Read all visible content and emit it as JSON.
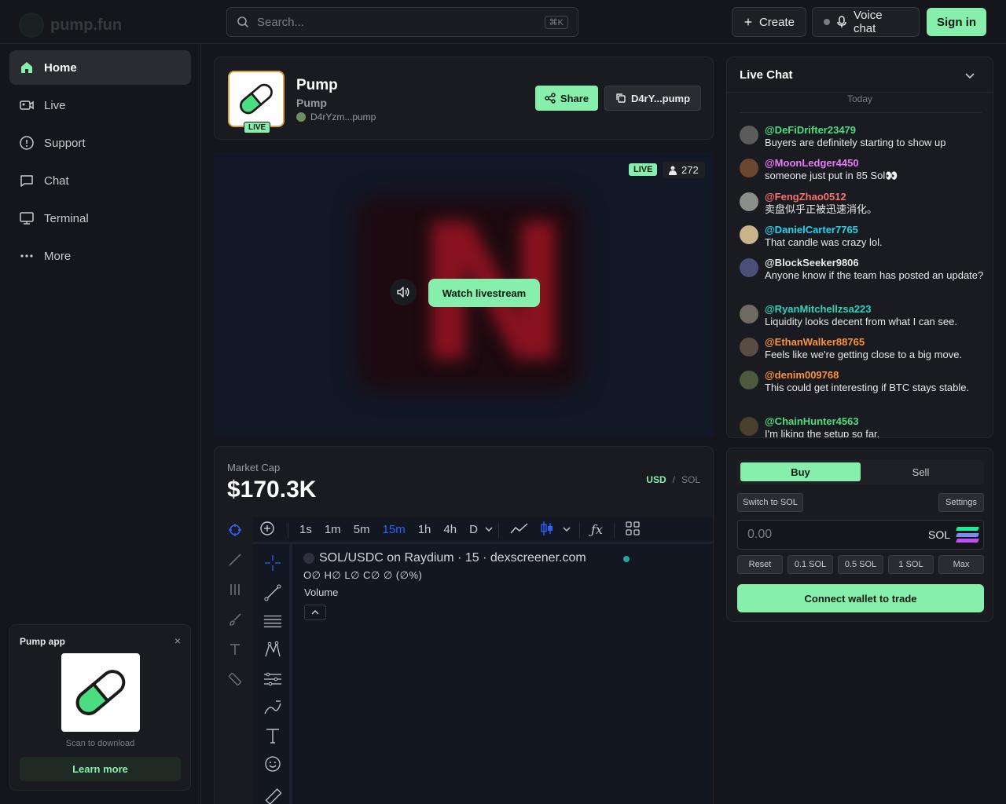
{
  "header": {
    "logo_text": "pump.fun",
    "search_placeholder": "Search...",
    "search_shortcut": "⌘K",
    "create_label": "Create",
    "voice_chat_label": "Voice chat",
    "sign_in_label": "Sign in"
  },
  "sidebar": {
    "items": [
      {
        "label": "Home",
        "icon": "home-icon",
        "active": true
      },
      {
        "label": "Live",
        "icon": "live-icon"
      },
      {
        "label": "Support",
        "icon": "support-icon"
      },
      {
        "label": "Chat",
        "icon": "chat-icon"
      },
      {
        "label": "Terminal",
        "icon": "terminal-icon"
      },
      {
        "label": "More",
        "icon": "more-icon"
      }
    ],
    "app_promo": {
      "title": "Pump app",
      "close": "×",
      "scan_text": "Scan to download",
      "learn_more": "Learn more"
    }
  },
  "token": {
    "name": "Pump",
    "ticker": "Pump",
    "creator": "D4rYzm...pump",
    "live_badge": "LIVE",
    "share_label": "Share",
    "contract_label": "D4rY...pump"
  },
  "stream": {
    "live_badge": "LIVE",
    "viewers": "272",
    "watch_label": "Watch livestream"
  },
  "market": {
    "cap_label": "Market Cap",
    "cap_value": "$170.3K",
    "currency_on": "USD",
    "currency_sep": "/",
    "currency_off": "SOL",
    "timeframes": [
      "1s",
      "1m",
      "5m",
      "15m",
      "1h",
      "4h",
      "D"
    ],
    "selected_timeframe": "15m",
    "pair_title": "SOL/USDC on Raydium · 15 · dexscreener.com",
    "ohlc": "O∅ H∅ L∅ C∅ ∅ (∅%)",
    "volume_label": "Volume"
  },
  "chat": {
    "title": "Live Chat",
    "day_label": "Today",
    "messages": [
      {
        "user": "@DeFiDrifter23479",
        "text": "Buyers are definitely starting to show up",
        "color": "#4ade80"
      },
      {
        "user": "@MoonLedger4450",
        "text": "someone just put in 85 Sol👀",
        "color": "#e879f9"
      },
      {
        "user": "@FengZhao0512",
        "text": "卖盘似乎正被迅速消化。",
        "color": "#f87171"
      },
      {
        "user": "@DanielCarter7765",
        "text": "That candle was crazy lol.",
        "color": "#22d3ee"
      },
      {
        "user": "@BlockSeeker9806",
        "text": "Anyone know if the team has posted an update?",
        "color": "#e8e8ea"
      },
      {
        "user": "@RyanMitchellzsa223",
        "text": "Liquidity looks decent from what I can see.",
        "color": "#2dd4bf"
      },
      {
        "user": "@EthanWalker88765",
        "text": "Feels like we're getting close to a big move.",
        "color": "#fb923c"
      },
      {
        "user": "@denim009768",
        "text": "This could get interesting if BTC stays stable.",
        "color": "#fb923c"
      },
      {
        "user": "@ChainHunter4563",
        "text": "I'm liking the setup so far.",
        "color": "#4ade80"
      }
    ]
  },
  "trade": {
    "buy_label": "Buy",
    "sell_label": "Sell",
    "switch_label": "Switch to SOL",
    "settings_label": "Settings",
    "amount_placeholder": "0.00",
    "amount_unit": "SOL",
    "quick_amounts": [
      "Reset",
      "0.1 SOL",
      "0.5 SOL",
      "1 SOL",
      "Max"
    ],
    "connect_label": "Connect wallet to trade"
  }
}
